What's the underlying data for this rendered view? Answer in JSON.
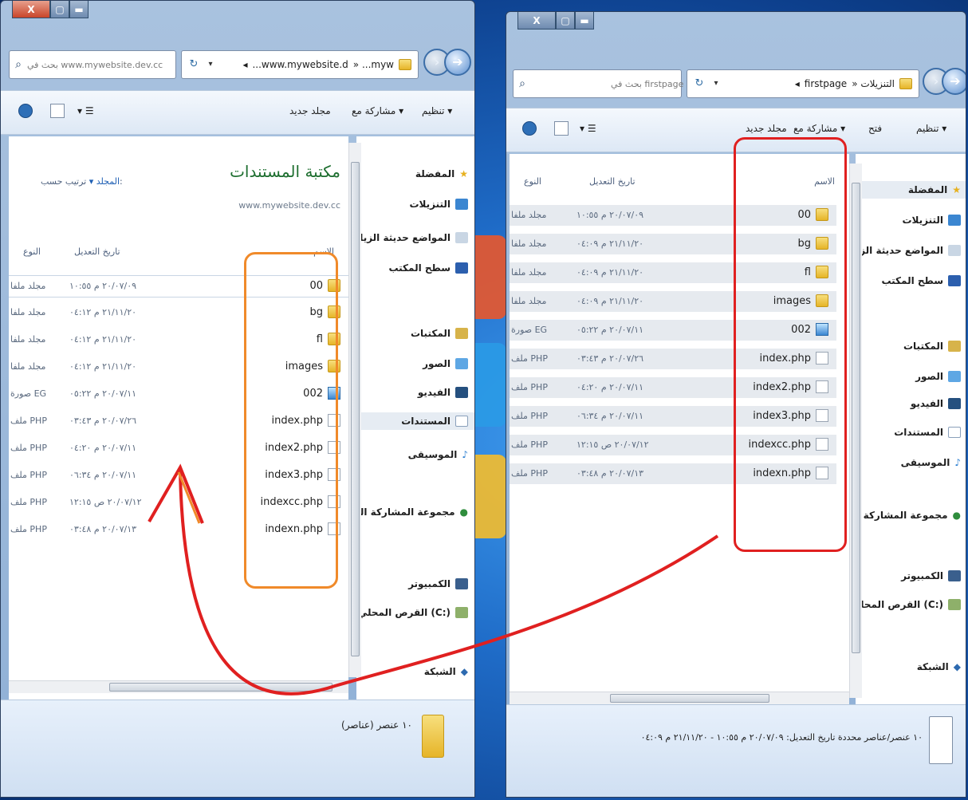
{
  "left_window": {
    "search_placeholder": "بحث في www.mywebsite.dev.cc",
    "breadcrumb": [
      "» ...myw",
      "...www.mywebsite.d",
      "◂"
    ],
    "toolbar": {
      "organize": "تنظيم ▾",
      "share_with": "مشاركة مع ▾",
      "new_folder": "مجلد جديد"
    },
    "nav": {
      "favorites": "المفضلة",
      "downloads": "التنزيلات",
      "recent_places": "المواضع حديثة الزيا",
      "desktop": "سطح المكتب",
      "libraries": "المكتبات",
      "pictures": "الصور",
      "videos": "الفيديو",
      "documents": "المستندات",
      "music": "الموسيقى",
      "homegroup": "مجموعة المشاركة المنـ",
      "computer": "الكمبيوتر",
      "local_disk": "القرص المحلي (C:)",
      "network": "الشبكة"
    },
    "library_title": "مكتبة المستندات",
    "library_path": "www.mywebsite.dev.cc",
    "sort_by_label": "ترتيب حسب:",
    "sort_by_value": "المجلد ▾",
    "columns": {
      "name": "الاسم",
      "date_modified": "تاريخ التعديل",
      "type": "النوع"
    },
    "files": [
      {
        "name": "00",
        "icon": "folder",
        "date": "٢٠/٠٧/٠٩ م ١٠:٥٥",
        "type": "مجلد ملفا"
      },
      {
        "name": "bg",
        "icon": "folder",
        "date": "٢١/١١/٢٠ م ٠٤:١٢",
        "type": "مجلد ملفا"
      },
      {
        "name": "fl",
        "icon": "folder",
        "date": "٢١/١١/٢٠ م ٠٤:١٢",
        "type": "مجلد ملفا"
      },
      {
        "name": "images",
        "icon": "folder",
        "date": "٢١/١١/٢٠ م ٠٤:١٢",
        "type": "مجلد ملفا"
      },
      {
        "name": "002",
        "icon": "image",
        "date": "٢٠/٠٧/١١ م ٠٥:٢٢",
        "type": "صورة EG"
      },
      {
        "name": "index.php",
        "icon": "php",
        "date": "٢٠/٠٧/٢٦ م ٠٣:٤٣",
        "type": "ملف PHP"
      },
      {
        "name": "index2.php",
        "icon": "php",
        "date": "٢٠/٠٧/١١ م ٠٤:٢٠",
        "type": "ملف PHP"
      },
      {
        "name": "index3.php",
        "icon": "php",
        "date": "٢٠/٠٧/١١ م ٠٦:٣٤",
        "type": "ملف PHP"
      },
      {
        "name": "indexcc.php",
        "icon": "php",
        "date": "٢٠/٠٧/١٢ ص ١٢:١٥",
        "type": "ملف PHP"
      },
      {
        "name": "indexn.php",
        "icon": "php",
        "date": "٢٠/٠٧/١٣ م ٠٣:٤٨",
        "type": "ملف PHP"
      }
    ],
    "status_text": "١٠ عنصر (عناصر)",
    "caption": {
      "close": "X",
      "max": "▢",
      "min": "▬"
    }
  },
  "right_window": {
    "search_placeholder": "بحث في firstpage",
    "breadcrumb": [
      "» التنزيلات",
      "firstpage",
      "◂"
    ],
    "toolbar": {
      "organize": "تنظيم ▾",
      "open": "فتح",
      "share_with": "مشاركة مع ▾",
      "new_folder": "مجلد جديد"
    },
    "nav": {
      "favorites": "المفضلة",
      "downloads": "التنزيلات",
      "recent_places": "المواضع حديثة الزيا",
      "desktop": "سطح المكتب",
      "libraries": "المكتبات",
      "pictures": "الصور",
      "videos": "الفيديو",
      "documents": "المستندات",
      "music": "الموسيقى",
      "homegroup": "مجموعة المشاركة المنـ",
      "computer": "الكمبيوتر",
      "local_disk": "القرص المحلي (C:)",
      "network": "الشبكة"
    },
    "columns": {
      "name": "الاسم",
      "date_modified": "تاريخ التعديل",
      "type": "النوع"
    },
    "files": [
      {
        "name": "00",
        "icon": "folder",
        "date": "٢٠/٠٧/٠٩ م ١٠:٥٥",
        "type": "مجلد ملفا"
      },
      {
        "name": "bg",
        "icon": "folder",
        "date": "٢١/١١/٢٠ م ٠٤:٠٩",
        "type": "مجلد ملفا"
      },
      {
        "name": "fl",
        "icon": "folder",
        "date": "٢١/١١/٢٠ م ٠٤:٠٩",
        "type": "مجلد ملفا"
      },
      {
        "name": "images",
        "icon": "folder",
        "date": "٢١/١١/٢٠ م ٠٤:٠٩",
        "type": "مجلد ملفا"
      },
      {
        "name": "002",
        "icon": "image",
        "date": "٢٠/٠٧/١١ م ٠٥:٢٢",
        "type": "صورة EG"
      },
      {
        "name": "index.php",
        "icon": "php",
        "date": "٢٠/٠٧/٢٦ م ٠٣:٤٣",
        "type": "ملف PHP"
      },
      {
        "name": "index2.php",
        "icon": "php",
        "date": "٢٠/٠٧/١١ م ٠٤:٢٠",
        "type": "ملف PHP"
      },
      {
        "name": "index3.php",
        "icon": "php",
        "date": "٢٠/٠٧/١١ م ٠٦:٣٤",
        "type": "ملف PHP"
      },
      {
        "name": "indexcc.php",
        "icon": "php",
        "date": "٢٠/٠٧/١٢ ص ١٢:١٥",
        "type": "ملف PHP"
      },
      {
        "name": "indexn.php",
        "icon": "php",
        "date": "٢٠/٠٧/١٣ م ٠٣:٤٨",
        "type": "ملف PHP"
      }
    ],
    "status_text": "١٠ عنصر/عناصر محددة تاريخ التعديل: ٢٠/٠٧/٠٩ م ١٠:٥٥ - ٢١/١١/٢٠ م ٠٤:٠٩",
    "caption": {
      "close": "X",
      "max": "▢",
      "min": "▬"
    }
  },
  "annotations": {
    "orange": "#f08a2a",
    "red": "#e02020"
  }
}
